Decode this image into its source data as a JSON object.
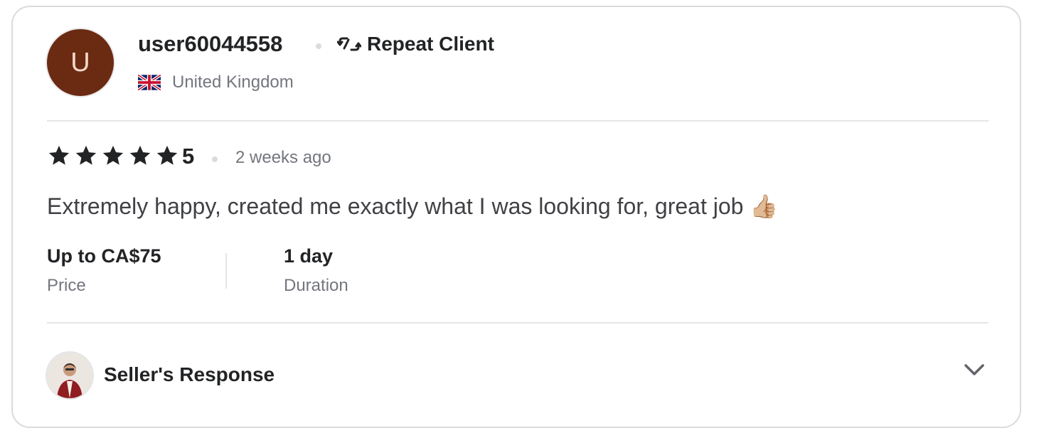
{
  "reviewer": {
    "avatar_letter": "U",
    "username": "user60044558",
    "badge_label": "Repeat Client",
    "country": "United Kingdom"
  },
  "review": {
    "stars": 5,
    "rating": "5",
    "time_ago": "2 weeks ago",
    "text": "Extremely happy, created me exactly what I was looking for, great job 👍🏼"
  },
  "details": {
    "price_value": "Up to CA$75",
    "price_label": "Price",
    "duration_value": "1 day",
    "duration_label": "Duration"
  },
  "seller_response": {
    "title": "Seller's Response"
  },
  "colors": {
    "avatar_bg": "#6b2a12",
    "star": "#222325",
    "muted_text": "#74767e",
    "border": "#dadbdd"
  },
  "icons": [
    "repeat-icon",
    "uk-flag-icon",
    "star-icon",
    "chevron-down-icon"
  ]
}
